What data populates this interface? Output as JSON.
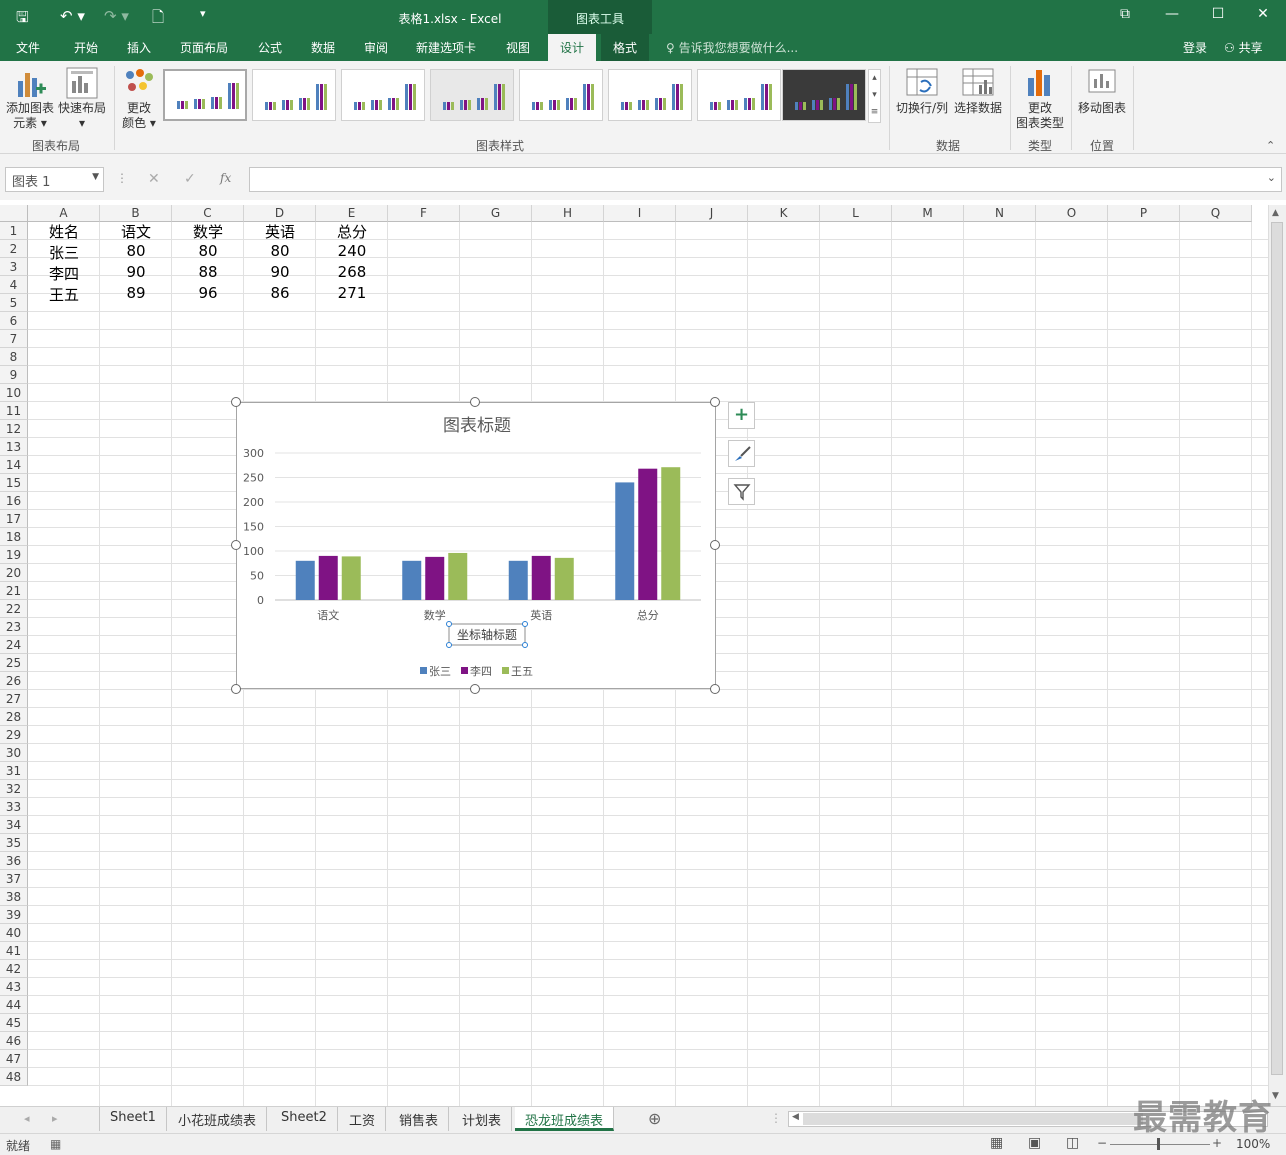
{
  "window": {
    "doc_title": "表格1.xlsx - Excel",
    "tools_label": "图表工具",
    "login": "登录",
    "share": "共享"
  },
  "menu": {
    "tabs": [
      "文件",
      "开始",
      "插入",
      "页面布局",
      "公式",
      "数据",
      "审阅",
      "新建选项卡",
      "视图",
      "设计",
      "格式"
    ],
    "active": "设计",
    "tellme": "告诉我您想要做什么..."
  },
  "ribbon": {
    "add_element": "添加图表",
    "add_element2": "元素",
    "quick_layout": "快速布局",
    "change_color": "更改",
    "change_color2": "颜色",
    "switch_rowcol": "切换行/列",
    "select_data": "选择数据",
    "change_type": "更改",
    "change_type2": "图表类型",
    "move_chart": "移动图表",
    "group_layout": "图表布局",
    "group_styles": "图表样式",
    "group_data": "数据",
    "group_type": "类型",
    "group_location": "位置"
  },
  "formula_bar": {
    "name_box": "图表 1",
    "fx": "fx",
    "cancel": "✕",
    "enter": "✓"
  },
  "columns": [
    "A",
    "B",
    "C",
    "D",
    "E",
    "F",
    "G",
    "H",
    "I",
    "J",
    "K",
    "L",
    "M",
    "N",
    "O",
    "P",
    "Q"
  ],
  "rows_count": 48,
  "table": {
    "header": [
      "姓名",
      "语文",
      "数学",
      "英语",
      "总分"
    ],
    "rows": [
      [
        "张三",
        "80",
        "80",
        "80",
        "240"
      ],
      [
        "李四",
        "90",
        "88",
        "90",
        "268"
      ],
      [
        "王五",
        "89",
        "96",
        "86",
        "271"
      ]
    ]
  },
  "chart_data": {
    "type": "bar",
    "title": "图表标题",
    "xlabel": "坐标轴标题",
    "ylabel": "",
    "categories": [
      "语文",
      "数学",
      "英语",
      "总分"
    ],
    "ylim": [
      0,
      300
    ],
    "yticks": [
      "0",
      "50",
      "100",
      "150",
      "200",
      "250",
      "300"
    ],
    "series": [
      {
        "name": "张三",
        "values": [
          80,
          80,
          80,
          240
        ],
        "color": "#4f81bd"
      },
      {
        "name": "李四",
        "values": [
          90,
          88,
          90,
          268
        ],
        "color": "#7f1384"
      },
      {
        "name": "王五",
        "values": [
          89,
          96,
          86,
          271
        ],
        "color": "#9bbb59"
      }
    ],
    "grid": true,
    "legend": "bottom"
  },
  "sheets": {
    "tabs": [
      "Sheet1",
      "小花班成绩表",
      "Sheet2",
      "工资",
      "销售表",
      "计划表",
      "恐龙班成绩表"
    ],
    "active": "恐龙班成绩表"
  },
  "status": {
    "ready": "就绪",
    "zoom": "100%"
  },
  "watermark": "最需教育",
  "colors": {
    "excel_green": "#217346"
  }
}
